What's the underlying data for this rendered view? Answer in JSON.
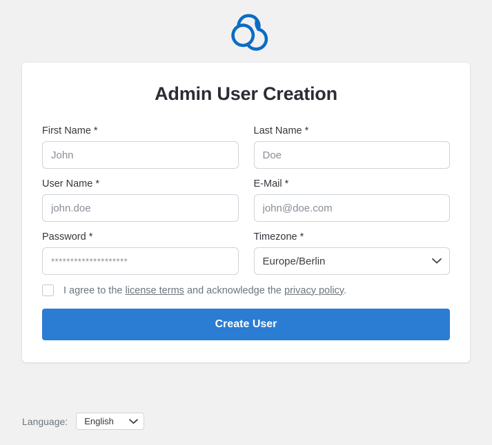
{
  "brand": {
    "logo_icon": "trefoil-clouds-logo",
    "logo_color": "#0b6cc4"
  },
  "card": {
    "title": "Admin User Creation",
    "fields": {
      "first_name": {
        "label": "First Name *",
        "placeholder": "John",
        "value": ""
      },
      "last_name": {
        "label": "Last Name *",
        "placeholder": "Doe",
        "value": ""
      },
      "user_name": {
        "label": "User Name *",
        "placeholder": "john.doe",
        "value": ""
      },
      "email": {
        "label": "E-Mail *",
        "placeholder": "john@doe.com",
        "value": ""
      },
      "password": {
        "label": "Password *",
        "placeholder": "********************",
        "value": ""
      },
      "timezone": {
        "label": "Timezone *",
        "selected": "Europe/Berlin",
        "chevron_icon": "chevron-down-icon"
      }
    },
    "consent": {
      "checked": false,
      "text_before": "I agree to the",
      "link_license": "license terms",
      "text_middle": "and acknowledge the",
      "link_privacy": "privacy policy",
      "text_after": "."
    },
    "submit_label": "Create User",
    "submit_color": "#2b7cd3"
  },
  "footer": {
    "language_label": "Language:",
    "language_selected": "English",
    "chevron_icon": "chevron-down-icon"
  }
}
